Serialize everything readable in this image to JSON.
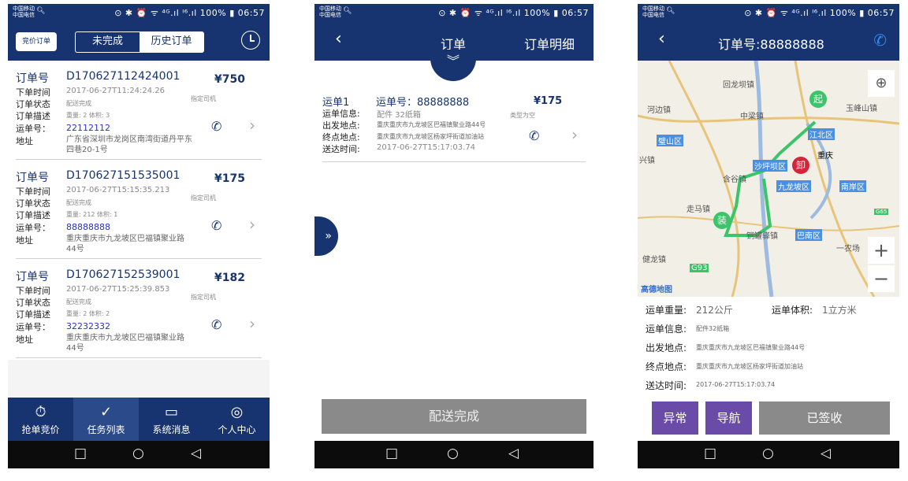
{
  "status": {
    "carrier": [
      "中国移动",
      "中国电信"
    ],
    "right": "⊙ ✱ ⏰ ᯤ ⁴ᴳ.ıl ᴵ⁶.ıl 100% ▮ 06:57"
  },
  "screen1": {
    "bid_btn": "竞价订单",
    "tabs": [
      "未完成",
      "历史订单"
    ],
    "labels": {
      "order_no": "订单号",
      "time": "下单时间",
      "state": "订单状态",
      "desc": "订单描述",
      "waybill": "运单号：",
      "addr": "地址"
    },
    "orders": [
      {
        "id": "D170627112424001",
        "price": "¥750",
        "time": "2017-06-27T11:24:24.26",
        "state": "配送完成",
        "desc": "重量: 2  体积: 3",
        "waybill": "22112112",
        "addr": "广东省深圳市龙岗区南湾街道丹平东四巷20-1号",
        "tag": "指定司机"
      },
      {
        "id": "D170627151535001",
        "price": "¥175",
        "time": "2017-06-27T15:15:35.213",
        "state": "配送完成",
        "desc": "重量: 212  体积: 1",
        "waybill": "88888888",
        "addr": "重庆重庆市九龙坡区巴福镇聚业路44号",
        "tag": "指定司机"
      },
      {
        "id": "D170627152539001",
        "price": "¥182",
        "time": "2017-06-27T15:25:39.853",
        "state": "配送完成",
        "desc": "重量: 2  体积: 2",
        "waybill": "32232332",
        "addr": "重庆重庆市九龙坡区巴福镇聚业路44号",
        "tag": "指定司机"
      }
    ],
    "tabbar": [
      {
        "label": "抢单竞价",
        "icon": "timer-icon"
      },
      {
        "label": "任务列表",
        "icon": "check-icon"
      },
      {
        "label": "系统消息",
        "icon": "message-icon"
      },
      {
        "label": "个人中心",
        "icon": "user-icon"
      }
    ]
  },
  "screen2": {
    "title": "订单",
    "detail": "订单明细",
    "item": {
      "seq": "运单1",
      "waybill": "运单号：88888888",
      "price": "¥175",
      "type": "类型为空",
      "info_label": "运单信息:",
      "info": "配件 32纸箱",
      "from_label": "出发地点:",
      "from": "重庆重庆市九龙坡区巴福镇聚业路44号",
      "to_label": "终点地点:",
      "to": "重庆重庆市九龙坡区杨家坪街道加油站",
      "time_label": "送达时间:",
      "time": "2017-06-27T15:17:03.74"
    },
    "done": "配送完成"
  },
  "screen3": {
    "title": "订单号:88888888",
    "map_labels": [
      "回龙坝镇",
      "河边镇",
      "中梁镇",
      "玉峰山镇",
      "江北区",
      "璧山区",
      "重庆",
      "沙坪坝区",
      "兴镇",
      "含谷镇",
      "九龙坡区",
      "南岸区",
      "走马镇",
      "铜罐驿镇",
      "巴南区",
      "一农场",
      "健龙镇",
      "G93",
      "G65",
      "高德地图"
    ],
    "markers": {
      "start": "起",
      "end": "卸",
      "load": "装"
    },
    "weight_label": "运单重量:",
    "weight": "212公斤",
    "volume_label": "运单体积:",
    "volume": "1立方米",
    "info_label": "运单信息:",
    "info": "配件32纸箱",
    "from_label": "出发地点:",
    "from": "重庆重庆市九龙坡区巴福镇聚业路44号",
    "to_label": "终点地点:",
    "to": "重庆重庆市九龙坡区杨家坪街道加油站",
    "time_label": "送达时间:",
    "time": "2017-06-27T15:17:03.74",
    "buttons": {
      "abnormal": "异常",
      "nav": "导航",
      "signed": "已签收"
    },
    "colors": {
      "abnormal": "#6a4ba8",
      "nav": "#6a4ba8",
      "signed": "#8a8a8a"
    }
  }
}
